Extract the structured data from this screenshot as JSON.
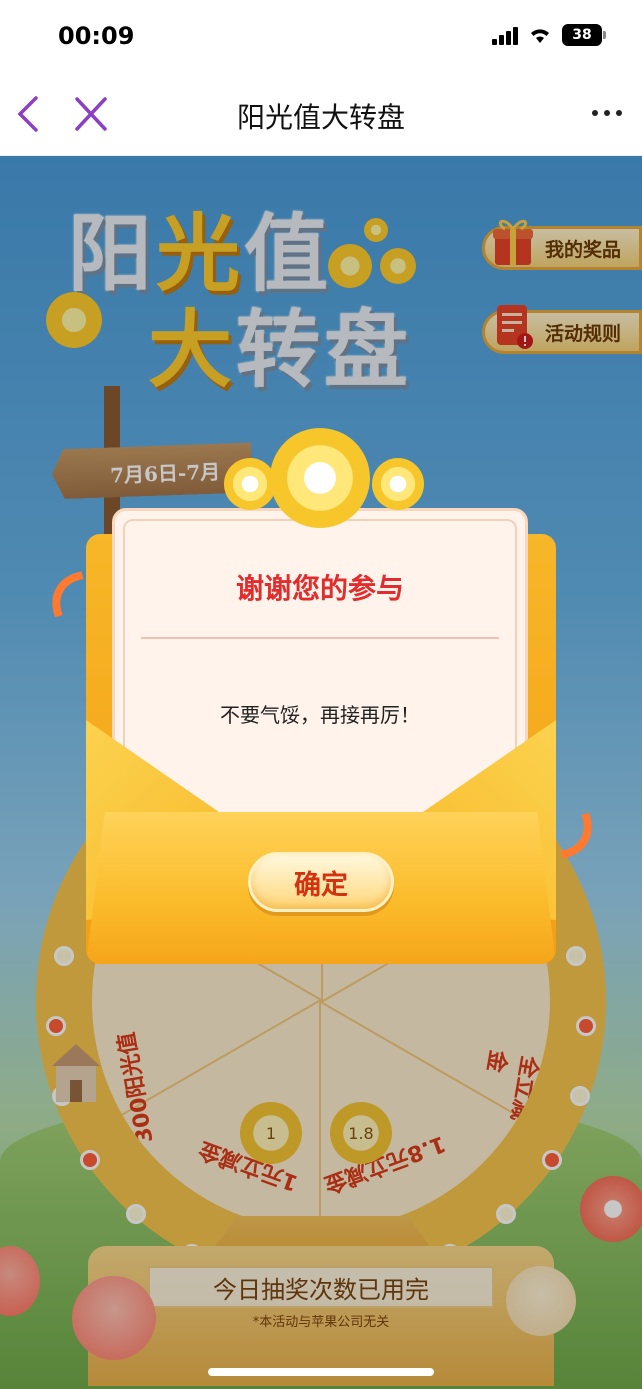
{
  "status_bar": {
    "time": "00:09",
    "battery": "38"
  },
  "nav": {
    "title": "阳光值大转盘",
    "back_icon": "chevron-left-icon",
    "close_icon": "close-icon",
    "more_icon": "more-dots-icon"
  },
  "hero": {
    "title_line1_a": "阳",
    "title_line1_b": "光",
    "title_line1_c": "值",
    "title_line2_a": "大",
    "title_line2_b": "转盘",
    "date_sign": "7月6日-7月"
  },
  "side_buttons": {
    "my_prizes": "我的奖品",
    "rules": "活动规则"
  },
  "wheel": {
    "segments": [
      "300阳光值",
      "1元立减金",
      "1.8元立减金",
      "全立减金"
    ],
    "coin_labels": [
      "1",
      "1.8"
    ]
  },
  "stand": {
    "status": "今日抽奖次数已用完",
    "disclaimer": "*本活动与苹果公司无关"
  },
  "modal": {
    "title": "谢谢您的参与",
    "message": "不要气馁，再接再厉！",
    "confirm_label": "确定"
  },
  "colors": {
    "accent_red": "#e12d2d",
    "gold": "#f5b11c",
    "sky": "#4a9bd9"
  }
}
